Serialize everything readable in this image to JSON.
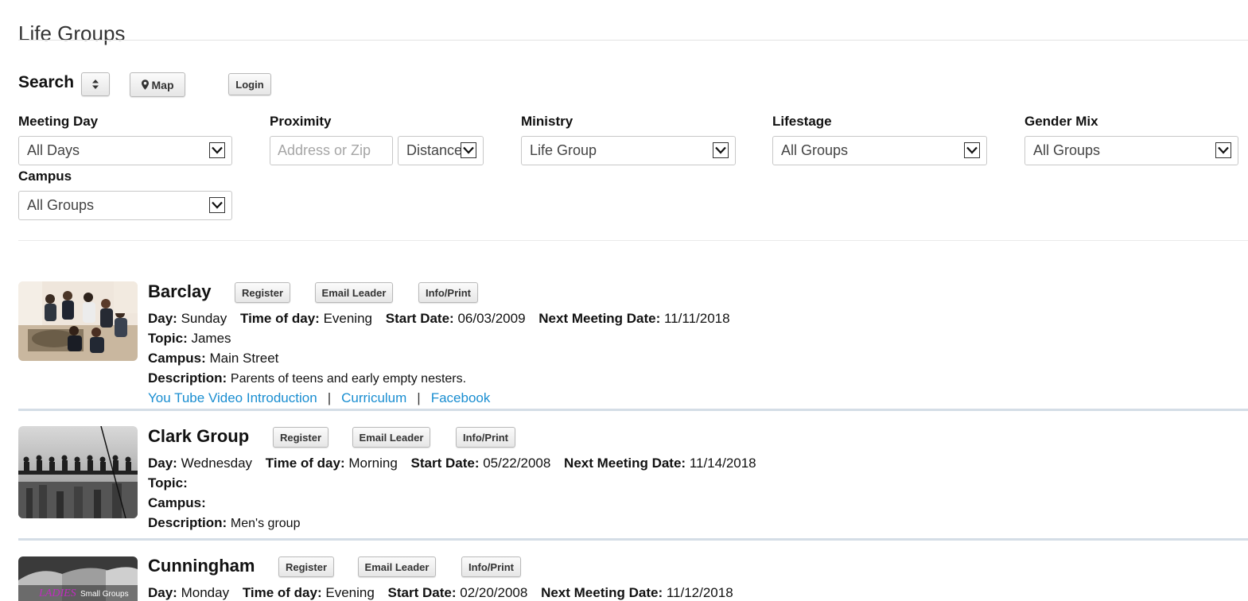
{
  "page": {
    "title": "Life Groups"
  },
  "search": {
    "label": "Search",
    "map_label": "Map",
    "login_label": "Login"
  },
  "filters": {
    "meeting_day": {
      "label": "Meeting Day",
      "value": "All Days"
    },
    "proximity": {
      "label": "Proximity",
      "placeholder": "Address or Zip",
      "distance_value": "Distance"
    },
    "ministry": {
      "label": "Ministry",
      "value": "Life Group"
    },
    "lifestage": {
      "label": "Lifestage",
      "value": "All Groups"
    },
    "gender_mix": {
      "label": "Gender Mix",
      "value": "All Groups"
    },
    "campus": {
      "label": "Campus",
      "value": "All Groups"
    }
  },
  "field_labels": {
    "day": "Day:",
    "time": "Time of day:",
    "start": "Start Date:",
    "next": "Next Meeting Date:",
    "topic": "Topic:",
    "campus": "Campus:",
    "description": "Description:"
  },
  "group_buttons": {
    "register": "Register",
    "email": "Email Leader",
    "info": "Info/Print"
  },
  "groups": [
    {
      "name": "Barclay",
      "day": "Sunday",
      "time": "Evening",
      "start": "06/03/2009",
      "next": "11/11/2018",
      "topic": "James",
      "campus": "Main Street",
      "description": "Parents of teens and early empty nesters.",
      "links": [
        "You Tube Video Introduction",
        "Curriculum",
        "Facebook"
      ]
    },
    {
      "name": "Clark Group",
      "day": "Wednesday",
      "time": "Morning",
      "start": "05/22/2008",
      "next": "11/14/2018",
      "topic": "",
      "campus": "",
      "description": "Men's group"
    },
    {
      "name": "Cunningham",
      "day": "Monday",
      "time": "Evening",
      "start": "02/20/2008",
      "next": "11/12/2018",
      "image_text": {
        "word": "LADIES",
        "rest": "Small Groups"
      }
    }
  ],
  "colors": {
    "link": "#1a8ed1",
    "divider": "#d4dde6"
  }
}
